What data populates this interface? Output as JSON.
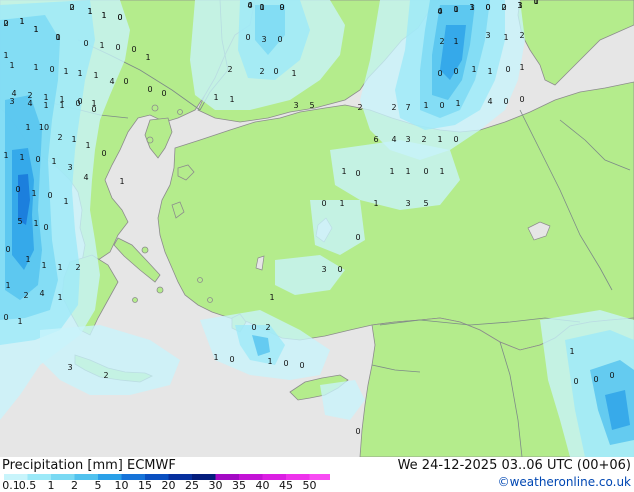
{
  "legend": {
    "title": "Precipitation [mm]",
    "model": "ECMWF",
    "classes": [
      {
        "label": "0.1",
        "color": "#c8f4fb"
      },
      {
        "label": "0.5",
        "color": "#9ce9f8"
      },
      {
        "label": "1",
        "color": "#7ad9f3"
      },
      {
        "label": "2",
        "color": "#52c2ee"
      },
      {
        "label": "5",
        "color": "#2aa0e8"
      },
      {
        "label": "10",
        "color": "#1673d8"
      },
      {
        "label": "15",
        "color": "#0a4fc0"
      },
      {
        "label": "20",
        "color": "#06309e"
      },
      {
        "label": "25",
        "color": "#041d7c"
      },
      {
        "label": "30",
        "color": "#a30ac4"
      },
      {
        "label": "35",
        "color": "#c313d6"
      },
      {
        "label": "40",
        "color": "#db1fe3"
      },
      {
        "label": "45",
        "color": "#ee33ec"
      },
      {
        "label": "50",
        "color": "#f84cf3"
      }
    ]
  },
  "valid_time": "We 24-12-2025 03..06 UTC (00+06)",
  "credit": "©weatheronline.co.uk",
  "map": {
    "colors": {
      "sea": "#e6e6e6",
      "land": "#b4ec8c",
      "border": "#7d8a88",
      "coast": "#8c8c8c"
    },
    "values": [
      "2",
      "1",
      "2",
      "1",
      "1",
      "0",
      "1",
      "4",
      "0",
      "9",
      "4",
      "0",
      "1",
      "0",
      "0",
      "1",
      "1",
      "1",
      "0",
      "1",
      "0",
      "0",
      "1",
      "0",
      "3",
      "0",
      "3",
      "2",
      "1",
      "1",
      "2",
      "1",
      "1",
      "0",
      "1",
      "1",
      "1",
      "1",
      "2",
      "2",
      "0",
      "1",
      "0",
      "0",
      "1",
      "1",
      "0",
      "1",
      "4",
      "2",
      "1",
      "1",
      "0",
      "1",
      "4",
      "0",
      "0",
      "0",
      "1",
      "1",
      "3",
      "4",
      "1",
      "1",
      "0",
      "0",
      "3",
      "5",
      "2",
      "2",
      "7",
      "1",
      "0",
      "1",
      "4",
      "0",
      "0",
      "1",
      "10",
      "2",
      "1",
      "1",
      "0",
      "6",
      "4",
      "3",
      "2",
      "1",
      "0",
      "1",
      "1",
      "0",
      "1",
      "3",
      "4",
      "1",
      "0",
      "1",
      "1",
      "0",
      "1",
      "0",
      "1",
      "0",
      "1",
      "1",
      "0",
      "1",
      "1",
      "3",
      "5",
      "5",
      "1",
      "0",
      "0",
      "0",
      "1",
      "1",
      "1",
      "2",
      "3",
      "0",
      "1",
      "2",
      "4",
      "1",
      "1",
      "0",
      "1",
      "0",
      "2",
      "3",
      "2",
      "1",
      "0",
      "1",
      "0",
      "0",
      "0",
      "1",
      "0",
      "0",
      "0",
      "0",
      "1",
      "0",
      "1",
      "1",
      "0",
      "1",
      "0",
      "1",
      "0",
      "0",
      "1",
      "3",
      "0",
      "2",
      "3",
      "0",
      "0"
    ]
  }
}
